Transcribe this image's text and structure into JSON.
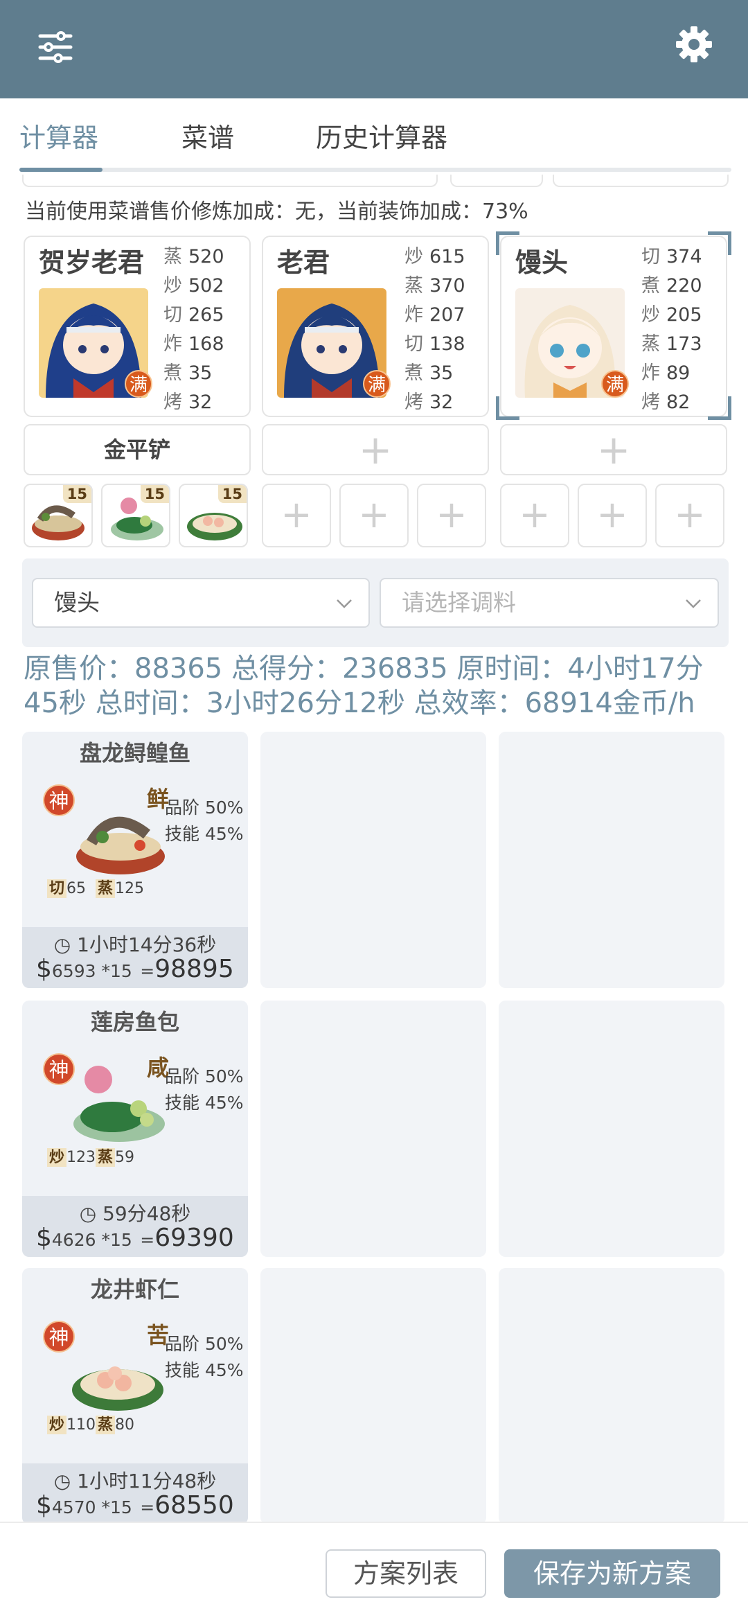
{
  "tabs": [
    {
      "label": "计算器",
      "active": true
    },
    {
      "label": "菜谱",
      "active": false
    },
    {
      "label": "历史计算器",
      "active": false
    }
  ],
  "bonus_text": "当前使用菜谱售价修炼加成：无，当前装饰加成：73%",
  "chefs": [
    {
      "name": "贺岁老君",
      "badge": "满",
      "skills": [
        {
          "n": "蒸",
          "v": "520"
        },
        {
          "n": "炒",
          "v": "502"
        },
        {
          "n": "切",
          "v": "265"
        },
        {
          "n": "炸",
          "v": "168"
        },
        {
          "n": "煮",
          "v": "35"
        },
        {
          "n": "烤",
          "v": "32"
        }
      ]
    },
    {
      "name": "老君",
      "badge": "满",
      "skills": [
        {
          "n": "炒",
          "v": "615"
        },
        {
          "n": "蒸",
          "v": "370"
        },
        {
          "n": "炸",
          "v": "207"
        },
        {
          "n": "切",
          "v": "138"
        },
        {
          "n": "煮",
          "v": "35"
        },
        {
          "n": "烤",
          "v": "32"
        }
      ]
    },
    {
      "name": "馒头",
      "badge": "满",
      "skills": [
        {
          "n": "切",
          "v": "374"
        },
        {
          "n": "煮",
          "v": "220"
        },
        {
          "n": "炒",
          "v": "205"
        },
        {
          "n": "蒸",
          "v": "173"
        },
        {
          "n": "炸",
          "v": "89"
        },
        {
          "n": "烤",
          "v": "82"
        }
      ]
    }
  ],
  "equipment": {
    "label": "金平铲",
    "add_symbol": "+"
  },
  "slot_counts": [
    "15",
    "15",
    "15"
  ],
  "selects": {
    "chef_value": "馒头",
    "condiment_placeholder": "请选择调料"
  },
  "summary": "原售价：88365 总得分：236835 原时间：4小时17分45秒 总时间：3小时26分12秒 总效率：68914金币/h",
  "dishes": [
    {
      "name": "盘龙鲟鳇鱼",
      "rank": "神",
      "taste": "鲜",
      "quality": "品阶 50%",
      "skill": "技能 45%",
      "req": [
        {
          "n": "切",
          "v": "65"
        },
        {
          "n": "蒸",
          "v": "125"
        }
      ],
      "time": "1小时14分36秒",
      "dollar": "$",
      "unit_price": "6593 *15",
      "eq": "=",
      "total": "98895"
    },
    {
      "name": "莲房鱼包",
      "rank": "神",
      "taste": "咸",
      "quality": "品阶 50%",
      "skill": "技能 45%",
      "req": [
        {
          "n": "炒",
          "v": "123"
        },
        {
          "n": "蒸",
          "v": "59"
        }
      ],
      "time": "59分48秒",
      "dollar": "$",
      "unit_price": "4626 *15",
      "eq": "=",
      "total": "69390"
    },
    {
      "name": "龙井虾仁",
      "rank": "神",
      "taste": "苦",
      "quality": "品阶 50%",
      "skill": "技能 45%",
      "req": [
        {
          "n": "炒",
          "v": "110"
        },
        {
          "n": "蒸",
          "v": "80"
        }
      ],
      "time": "1小时11分48秒",
      "dollar": "$",
      "unit_price": "4570 *15",
      "eq": "=",
      "total": "68550"
    }
  ],
  "buttons": {
    "plan_list": "方案列表",
    "save_new": "保存为新方案"
  },
  "colors": {
    "header": "#5f7d8e",
    "accent": "#6f8fa3",
    "primary_button": "#7d97a8",
    "badge": "#d85a1d"
  }
}
